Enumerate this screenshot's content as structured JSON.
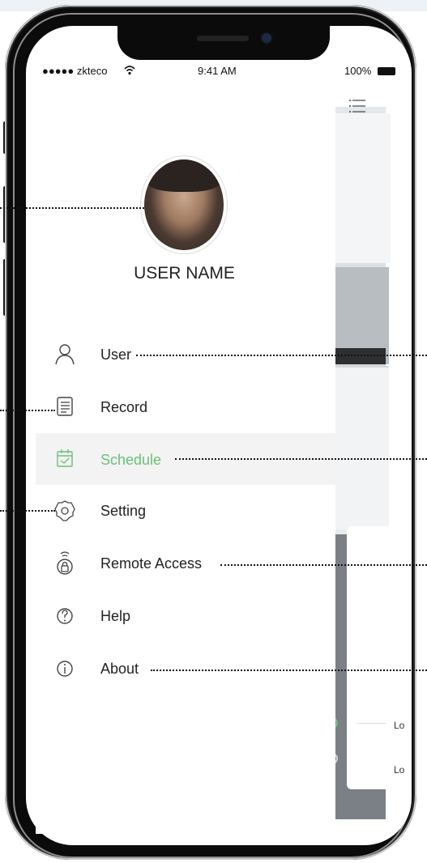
{
  "status_bar": {
    "carrier": "●●●●● zkteco",
    "time": "9:41 AM",
    "battery": "100%"
  },
  "user": {
    "name": "USER NAME"
  },
  "menu": {
    "items": [
      {
        "label": "User",
        "icon": "user-icon",
        "active": false
      },
      {
        "label": "Record",
        "icon": "record-list-icon",
        "active": false
      },
      {
        "label": "Schedule",
        "icon": "calendar-check-icon",
        "active": true
      },
      {
        "label": "Setting",
        "icon": "gear-icon",
        "active": false
      },
      {
        "label": "Remote Access",
        "icon": "remote-lock-icon",
        "active": false
      },
      {
        "label": "Help",
        "icon": "help-icon",
        "active": false
      },
      {
        "label": "About",
        "icon": "info-icon",
        "active": false
      }
    ]
  },
  "background_app": {
    "row_1": "Lo",
    "row_2": "Lo"
  },
  "colors": {
    "accent": "#6cbf7a",
    "highlight_row": "#f3f3f3",
    "text": "#222222"
  }
}
